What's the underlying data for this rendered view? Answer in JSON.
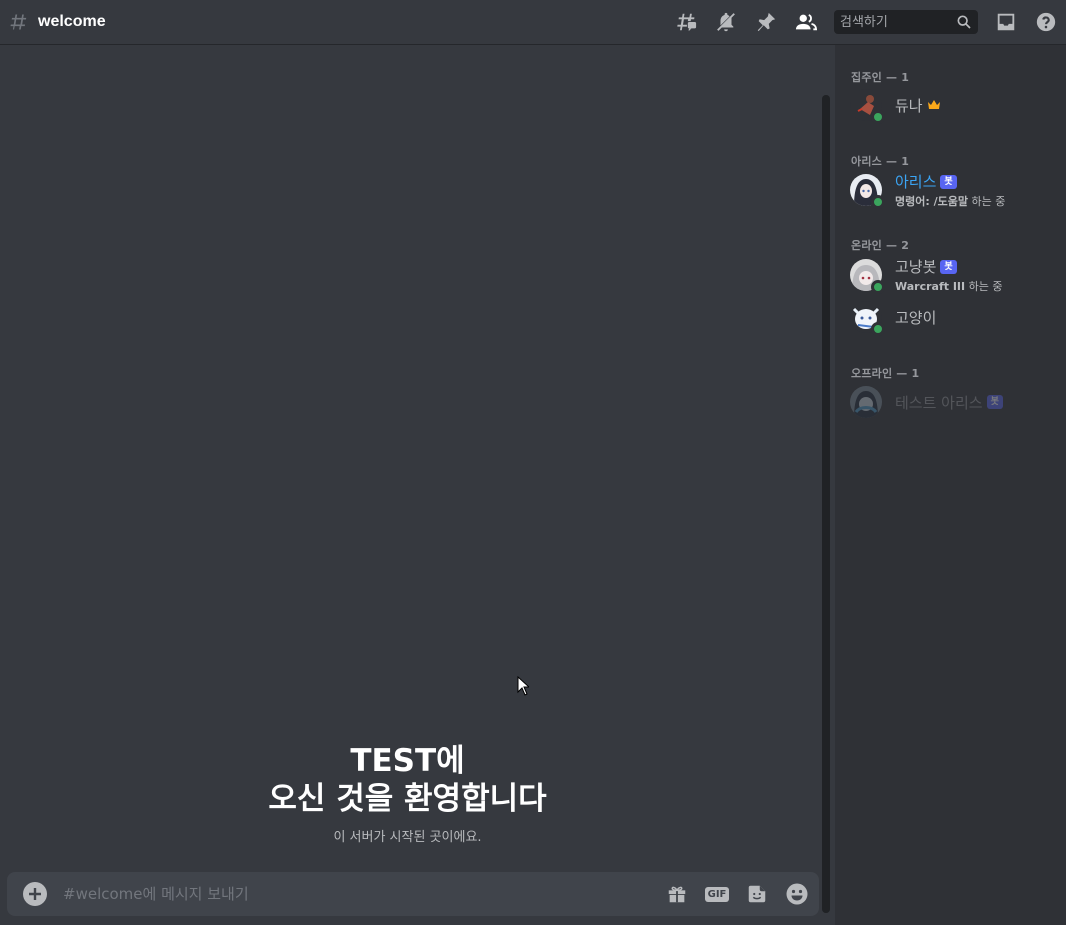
{
  "header": {
    "channel_name": "welcome",
    "search_placeholder": "검색하기",
    "icons": [
      "threads-icon",
      "mute-bell-icon",
      "pin-icon",
      "members-icon",
      "search-icon",
      "inbox-icon",
      "help-icon"
    ]
  },
  "welcome": {
    "title_line1": "TEST에",
    "title_line2": "오신 것을 환영합니다",
    "subtitle": "이 서버가 시작된 곳이에요."
  },
  "composer": {
    "placeholder": "#welcome에 메시지 보내기",
    "gif_label": "GIF",
    "icons": [
      "add-attachment-icon",
      "gift-icon",
      "gif-icon",
      "sticker-icon",
      "emoji-icon"
    ]
  },
  "members": {
    "sections": [
      {
        "title": "집주인 — 1"
      },
      {
        "title": "아리스 — 1"
      },
      {
        "title": "온라인 — 2"
      },
      {
        "title": "오프라인 — 1"
      }
    ],
    "items": [
      {
        "name": "듀나",
        "owner": true,
        "status": "online"
      },
      {
        "name": "아리스",
        "bot_tag": "봇",
        "activity_bold": "명령어: /도움말",
        "activity_rest": " 하는 중",
        "status": "online",
        "name_color": "#3ba5f5"
      },
      {
        "name": "고냥봇",
        "bot_tag": "봇",
        "activity_bold": "Warcraft III",
        "activity_rest": " 하는 중",
        "status": "online"
      },
      {
        "name": "고양이",
        "status": "online"
      },
      {
        "name": "테스트 아리스",
        "bot_tag": "봇",
        "status": "offline"
      }
    ]
  },
  "colors": {
    "background": "#36393f",
    "sidebar": "#2f3136",
    "online": "#3ba55d",
    "bot_tag": "#5865f2",
    "role_name": "#3ba5f5",
    "crown": "#faa81a"
  }
}
